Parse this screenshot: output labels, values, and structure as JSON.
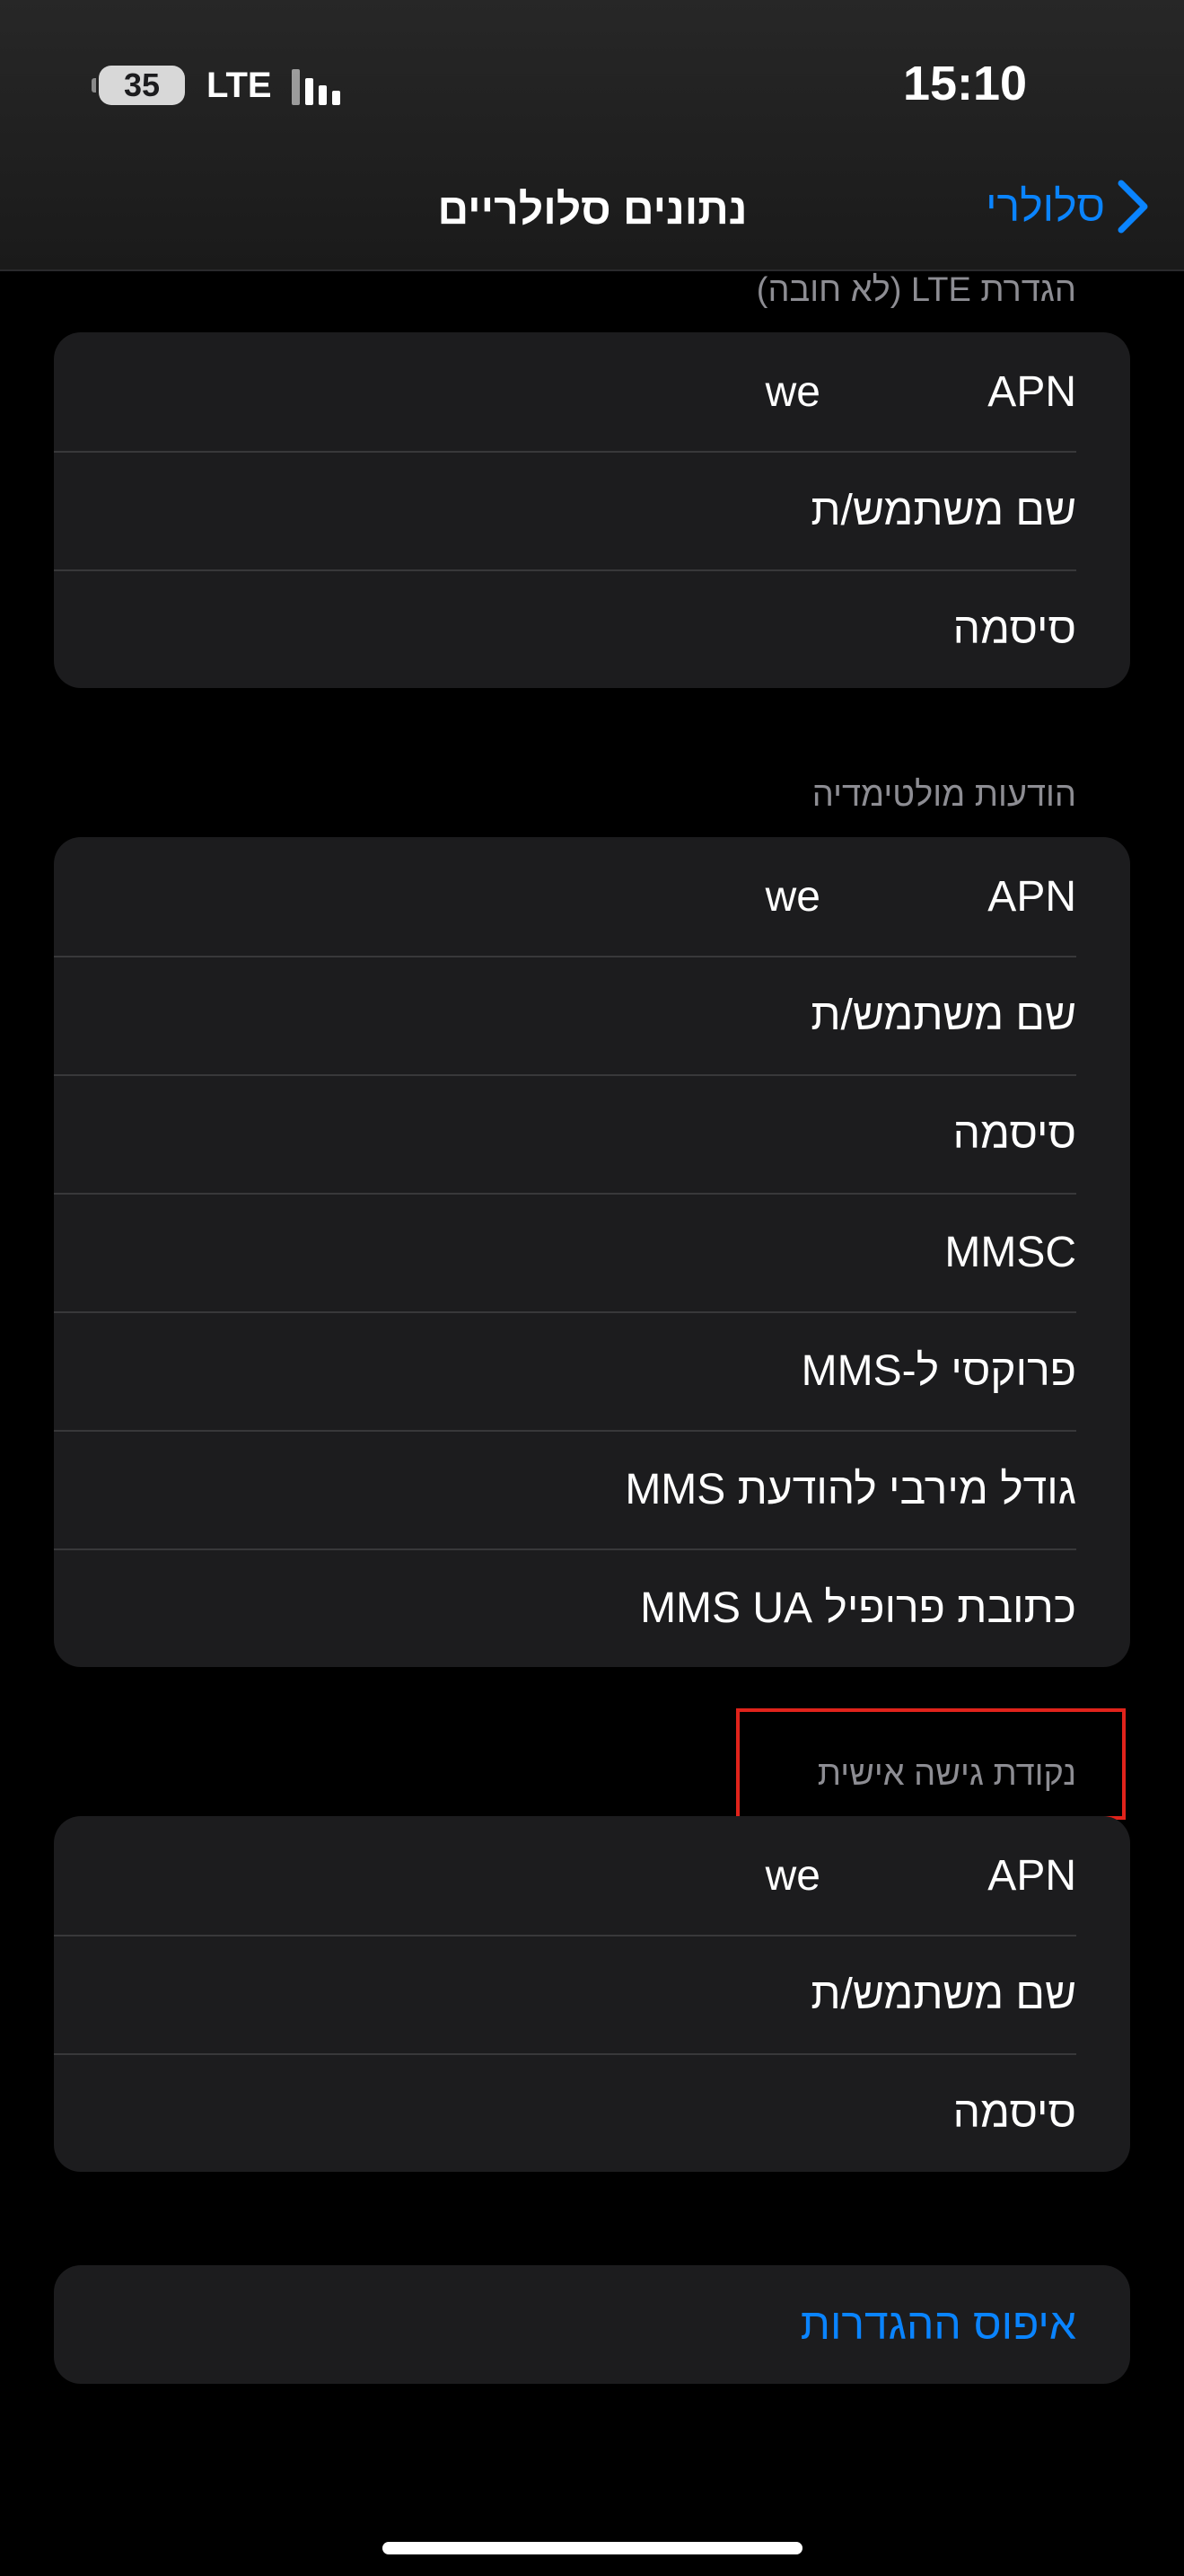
{
  "status_bar": {
    "time": "15:10",
    "battery": "35",
    "network": "LTE"
  },
  "nav": {
    "title": "נתונים סלולריים",
    "back_label": "סלולרי",
    "back_icon": "chevron-right-icon"
  },
  "sections": {
    "lte": {
      "header": "הגדרת LTE (לא חובה)",
      "rows": [
        {
          "label": "APN",
          "value": "we"
        },
        {
          "label": "שם משתמש/ת",
          "value": ""
        },
        {
          "label": "סיסמה",
          "value": ""
        }
      ]
    },
    "mms": {
      "header": "הודעות מולטימדיה",
      "rows": [
        {
          "label": "APN",
          "value": "we"
        },
        {
          "label": "שם משתמש/ת",
          "value": ""
        },
        {
          "label": "סיסמה",
          "value": ""
        },
        {
          "label": "MMSC",
          "value": ""
        },
        {
          "label": "פרוקסי ל-MMS",
          "value": ""
        },
        {
          "label": "גודל מירבי להודעת MMS",
          "value": ""
        },
        {
          "label": "כתובת פרופיל MMS UA",
          "value": ""
        }
      ]
    },
    "hotspot": {
      "header": "נקודת גישה אישית",
      "rows": [
        {
          "label": "APN",
          "value": "we"
        },
        {
          "label": "שם משתמש/ת",
          "value": ""
        },
        {
          "label": "סיסמה",
          "value": ""
        }
      ]
    }
  },
  "reset": {
    "label": "איפוס ההגדרות"
  },
  "colors": {
    "accent": "#0a84ff",
    "background": "#000000",
    "group_background": "#1c1c1e",
    "highlight": "#e0231b"
  }
}
